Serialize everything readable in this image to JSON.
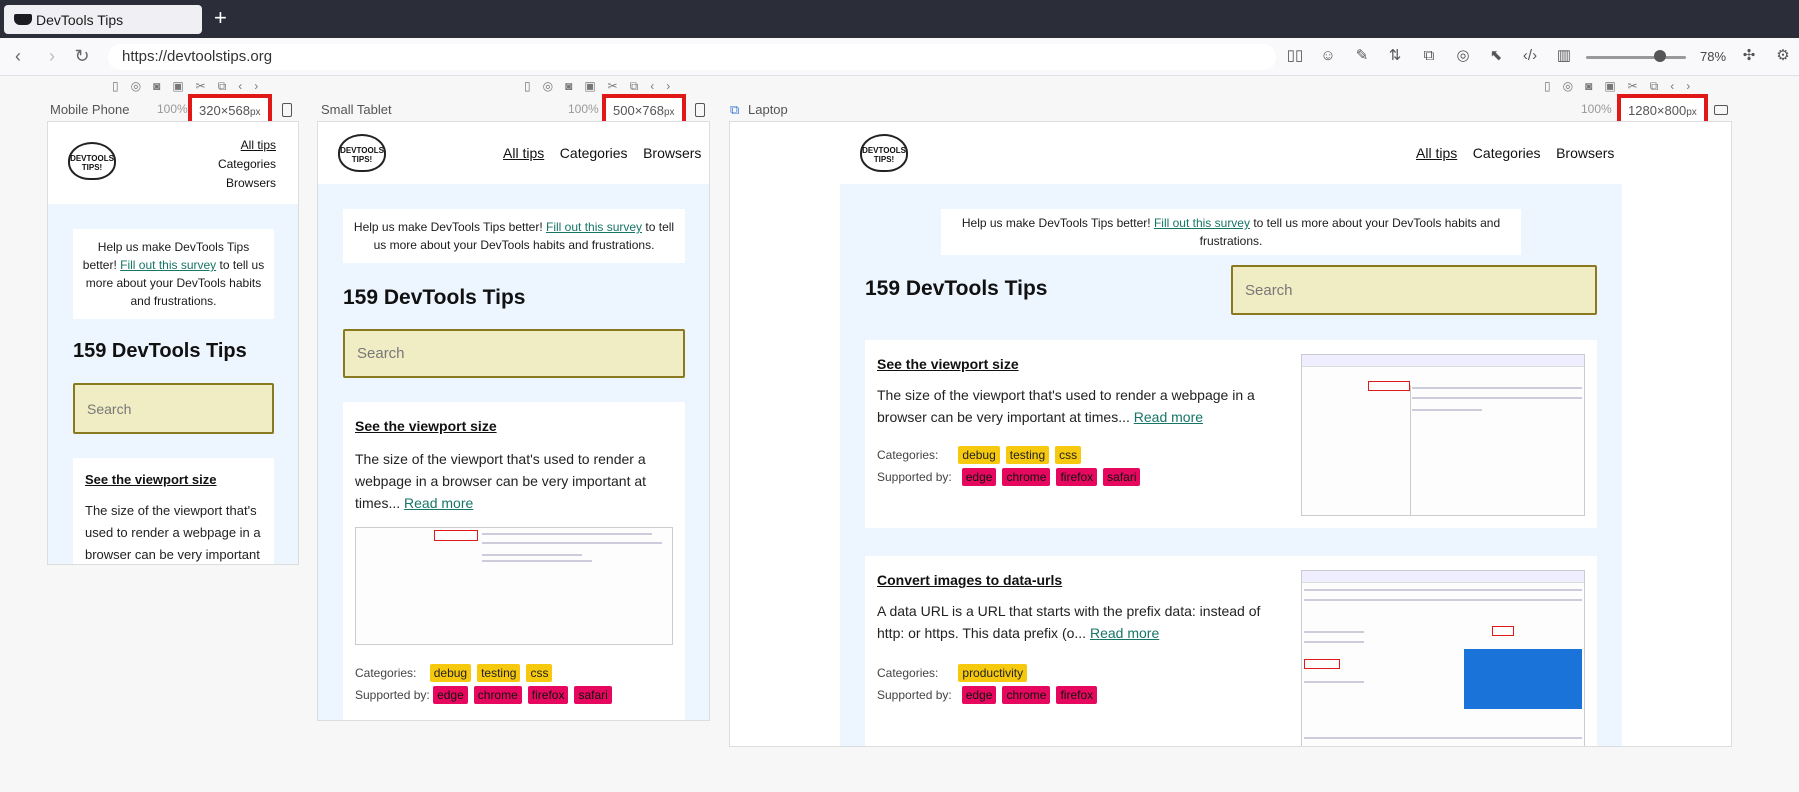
{
  "browser": {
    "tab_title": "DevTools Tips",
    "new_tab": "+",
    "url": "https://devtoolstips.org",
    "zoom": "78%"
  },
  "devices": [
    {
      "label": "Mobile Phone",
      "zoom": "100%",
      "w": "320",
      "h": "568",
      "unit": "px"
    },
    {
      "label": "Small Tablet",
      "zoom": "100%",
      "w": "500",
      "h": "768",
      "unit": "px"
    },
    {
      "label": "Laptop",
      "zoom": "100%",
      "w": "1280",
      "h": "800",
      "unit": "px"
    }
  ],
  "times_sign": "×",
  "site": {
    "logo_top": "DEVTOOLS",
    "logo_bottom": "TIPS!",
    "nav": {
      "all": "All tips",
      "categories": "Categories",
      "browsers": "Browsers"
    },
    "banner_pre": "Help us make DevTools Tips better!",
    "banner_link": "Fill out this survey",
    "banner_post": "to tell us more about your DevTools habits and frustrations.",
    "heading": "159 DevTools Tips",
    "search_placeholder": "Search",
    "categories_label": "Categories:",
    "supported_label": "Supported by:",
    "read_more": "Read more",
    "tips": [
      {
        "title": "See the viewport size",
        "excerpt": "The size of the viewport that's used to render a webpage in a browser can be very important at times...",
        "categories": [
          "debug",
          "testing",
          "css"
        ],
        "browsers": [
          "edge",
          "chrome",
          "firefox",
          "safari"
        ]
      },
      {
        "title": "Convert images to data-urls",
        "excerpt": "A data URL is a URL that starts with the prefix data: instead of http: or https. This data prefix (o...",
        "categories": [
          "productivity"
        ],
        "browsers": [
          "edge",
          "chrome",
          "firefox"
        ]
      }
    ]
  },
  "colors": {
    "category_tag": "#f6c90e",
    "browser_tag": "#e5085e",
    "highlight": "#e01818",
    "search_bg": "#f0edc5"
  }
}
